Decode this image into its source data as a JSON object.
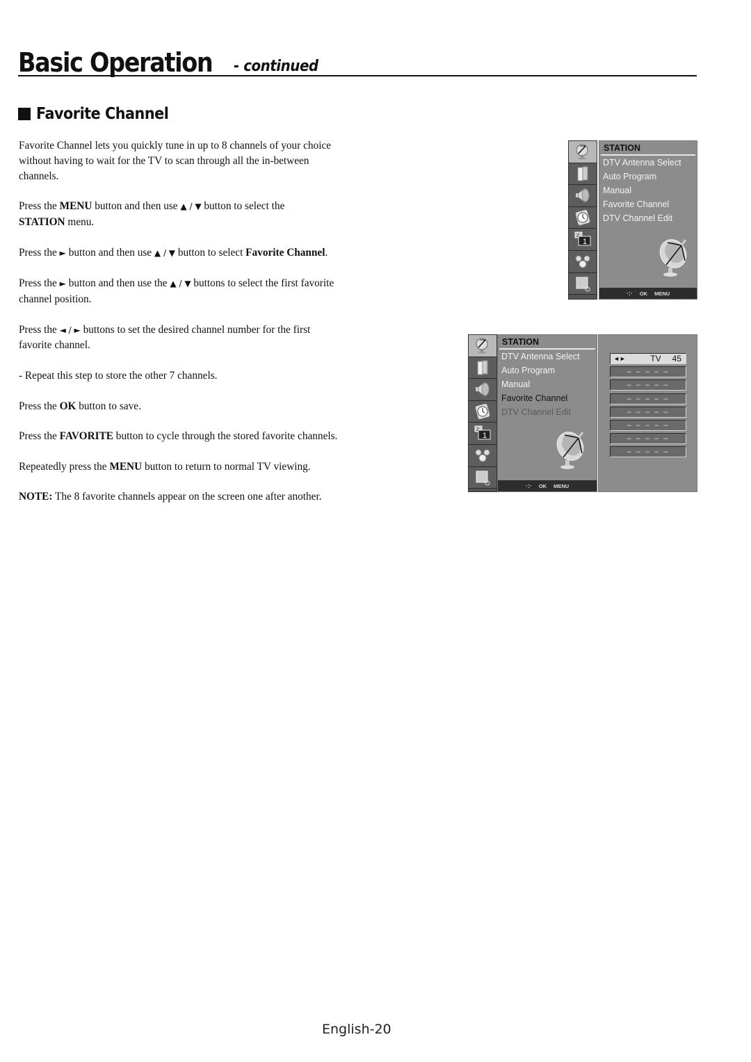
{
  "header": {
    "title": "Basic Operation",
    "subtitle": "- continued"
  },
  "section": {
    "title": "Favorite Channel"
  },
  "instructions": {
    "intro": "Favorite Channel lets you quickly tune in up to 8 channels of your choice without having to wait for the TV to scan through all the in-between channels.",
    "step1": {
      "a": "Press the ",
      "b1": "MENU",
      "c": " button and then use ",
      "arrows": "▲ / ▼",
      "d": " button to select the ",
      "b2": "STATION",
      "e": " menu."
    },
    "step2": {
      "a": "Press the ",
      "arrow": "►",
      "c": " button and then use ",
      "arrows": "▲ / ▼",
      "d": " button to select ",
      "b": "Favorite Channel",
      "e": "."
    },
    "step3": {
      "a": "Press the ",
      "arrow": "►",
      "c": " button and then use the ",
      "arrows": "▲ / ▼",
      "d": " buttons to select the first favorite channel position."
    },
    "step4": {
      "a": "Press the ",
      "arrows": "◄ / ►",
      "d": " buttons to set the desired channel number for the first favorite channel."
    },
    "step4_note": "-  Repeat this step to store the other 7 channels.",
    "step5": {
      "a": "Press the ",
      "b": "OK",
      "c": " button to save."
    },
    "step6": {
      "a": "Press the ",
      "b": "FAVORITE",
      "c": " button to cycle through the stored favorite channels."
    },
    "step7": {
      "a": "Repeatedly press the ",
      "b": "MENU",
      "c": " button to return to normal TV viewing."
    },
    "note": {
      "b": "NOTE:",
      "c": " The 8 favorite channels appear on the screen one after another."
    }
  },
  "menu1": {
    "heading": "STATION",
    "items": [
      "DTV Antenna Select",
      "Auto Program",
      "Manual",
      "Favorite Channel",
      "DTV Channel Edit"
    ],
    "bar": {
      "nav": "·:·",
      "ok": "OK",
      "menu": "MENU"
    },
    "icons": [
      "station-icon",
      "picture-icon",
      "audio-icon",
      "time-icon",
      "pip-icon",
      "option-icon",
      "lock-icon"
    ]
  },
  "menu2": {
    "heading": "STATION",
    "items": [
      "DTV Antenna Select",
      "Auto Program",
      "Manual",
      "Favorite Channel",
      "DTV Channel Edit"
    ],
    "selected_index": 3,
    "bar": {
      "nav": "·:·",
      "ok": "OK",
      "menu": "MENU"
    },
    "favorites": {
      "first": {
        "arrows": "◄►",
        "source": "TV",
        "channel": "45"
      },
      "empty_slots": [
        "– – – – –",
        "– – – – –",
        "– – – – –",
        "– – – – –",
        "– – – – –",
        "– – – – –",
        "– – – – –"
      ]
    }
  },
  "footer": {
    "page_label": "English-20"
  }
}
